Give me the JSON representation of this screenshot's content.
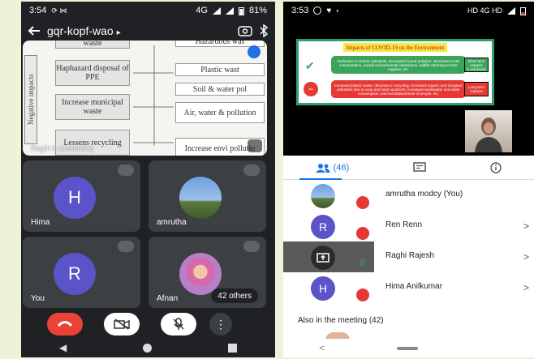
{
  "left_phone": {
    "status": {
      "time": "3:54",
      "left_icons": "⟳ ⋈",
      "right_text": "4G",
      "battery": "81%"
    },
    "meeting_code": "gqr-kopf-wao",
    "presentation": {
      "vertical_label": "Negative impacts",
      "boxes": [
        "waste",
        "Haphazard disposal of PPE",
        "Increase municipal waste",
        "Lessens recycling"
      ],
      "right_boxes": [
        "Hazardous was",
        "Plastic wast",
        "Soil & water pol",
        "Air, water & pollution",
        "Increase envi pollutio"
      ],
      "watermark": "Raghi is presenting"
    },
    "tiles": [
      {
        "name": "Hima",
        "initial": "H",
        "color": "#5b54c9"
      },
      {
        "name": "amrutha",
        "initial": "",
        "color": "#6a8fbf"
      },
      {
        "name": "You",
        "initial": "R",
        "color": "#5b54c9"
      },
      {
        "name": "Afnan",
        "initial": "",
        "color": "#c79ad2"
      }
    ],
    "others_label": "42 others"
  },
  "right_phone": {
    "status": {
      "time": "3:53",
      "right_text": "HD 4G HD"
    },
    "slide": {
      "title": "Impacts of COVID-19 on the Environment",
      "row1": "Reduction in vehicle pollutants, decreased sound pollution, decreased GHG concentration, overall environmental cleanliness, wildlife returning to their regimes, etc.",
      "row2": "Increased plastic waste, decrease in recycling, increased organic and inorganic pollutants due to soap and hand sanitizers, increased wastewater and water consumption, internal displacement of people, etc.",
      "side1": "Short term impacts (Lockdown)",
      "side2": "Long term impacts"
    },
    "tabs": {
      "people_count": "(46)"
    },
    "participants": [
      {
        "name": "amrutha modcy (You)",
        "initial": "",
        "color": "#6a8fbf"
      },
      {
        "name": "Ren Renn",
        "initial": "R",
        "color": "#5b54c9"
      },
      {
        "name": "Raghi Rajesh",
        "initial": "",
        "color": "#3c4043"
      },
      {
        "name": "Hima Anilkumar",
        "initial": "H",
        "color": "#5b54c9"
      }
    ],
    "also_label": "Also in the meeting (42)"
  },
  "colors": {
    "red": "#ea4335",
    "blue": "#1a73e8",
    "dark": "#202124",
    "tile": "#3c4043"
  }
}
